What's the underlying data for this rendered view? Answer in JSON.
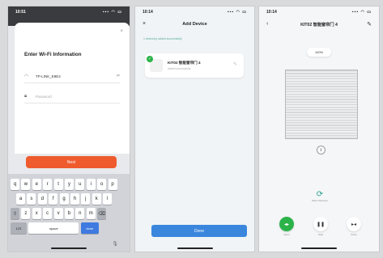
{
  "screen1": {
    "status_time": "10:51",
    "status_signal": "▪▪▪ ◠ ▭",
    "title": "Enter Wi-Fi Information",
    "close": "×",
    "ssid_value": "TP-LINK_E9E4",
    "password_placeholder": "Password",
    "next_label": "Next",
    "keys_row1": [
      "q",
      "w",
      "e",
      "r",
      "t",
      "y",
      "u",
      "i",
      "o",
      "p"
    ],
    "keys_row2": [
      "a",
      "s",
      "d",
      "f",
      "g",
      "h",
      "j",
      "k",
      "l"
    ],
    "keys_row3": [
      "z",
      "x",
      "c",
      "v",
      "b",
      "n",
      "m"
    ],
    "shift": "⇧",
    "backspace": "⌫",
    "key_123": "123",
    "key_space": "space",
    "key_done": "done"
  },
  "screen2": {
    "status_time": "10:14",
    "status_signal": "▪▪▪ ◠ ▭",
    "title": "Add Device",
    "close": "×",
    "hint": "1 device(s) added successfully",
    "device_name": "KIT02 智能窗帘门 4",
    "device_sub": "Added successfully",
    "done_label": "Done"
  },
  "screen3": {
    "status_time": "10:14",
    "status_signal": "▪▪▪ ◠ ▭",
    "title": "KIT02 智能窗帘门 4",
    "back": "‹",
    "edit": "✎",
    "position": "100%",
    "reverse_label": "Motor Reverse",
    "open_label": "Open",
    "stop_label": "Stop",
    "close_label": "Close"
  },
  "colors": {
    "next_button": "#ef5b2c",
    "done_button": "#3a86dd",
    "success_green": "#2bb34a"
  }
}
